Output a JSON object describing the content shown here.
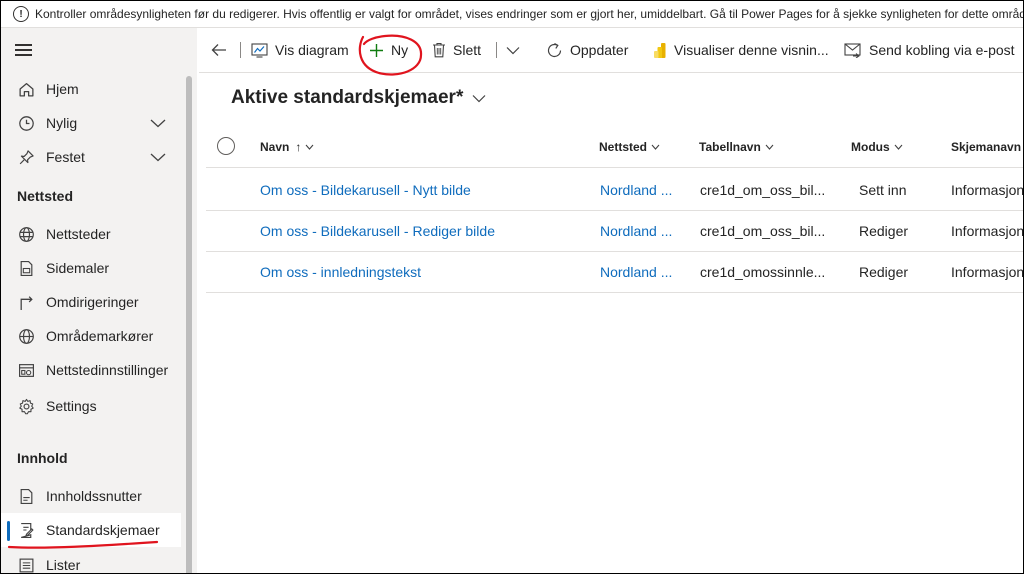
{
  "notice": {
    "icon": "info-icon",
    "text": "Kontroller områdesynligheten før du redigerer. Hvis offentlig er valgt for området, vises endringer som er gjort her, umiddelbart. Gå til Power Pages for å sjekke synligheten for dette området"
  },
  "sidebar": {
    "items": [
      {
        "label": "Hjem",
        "icon": "home-icon"
      },
      {
        "label": "Nylig",
        "icon": "clock-icon",
        "expandable": true
      },
      {
        "label": "Festet",
        "icon": "pin-icon",
        "expandable": true
      }
    ],
    "sections": [
      {
        "title": "Nettsted",
        "items": [
          {
            "label": "Nettsteder",
            "icon": "globe-icon"
          },
          {
            "label": "Sidemaler",
            "icon": "page-template-icon"
          },
          {
            "label": "Omdirigeringer",
            "icon": "redirect-icon"
          },
          {
            "label": "Områdemarkører",
            "icon": "site-marker-icon"
          },
          {
            "label": "Nettstedinnstillinger",
            "icon": "site-settings-icon"
          },
          {
            "label": "Settings",
            "icon": "gear-icon"
          }
        ]
      },
      {
        "title": "Innhold",
        "items": [
          {
            "label": "Innholdssnutter",
            "icon": "snippet-icon"
          },
          {
            "label": "Standardskjemaer",
            "icon": "form-icon",
            "selected": true
          },
          {
            "label": "Lister",
            "icon": "list-icon"
          }
        ]
      }
    ]
  },
  "commandbar": {
    "back": "back-arrow-icon",
    "vis_diagram": "Vis diagram",
    "ny": "Ny",
    "slett": "Slett",
    "oppdater": "Oppdater",
    "visualiser": "Visualiser denne visnin...",
    "send_kobling": "Send kobling via e-post"
  },
  "view": {
    "title": "Aktive standardskjemaer*"
  },
  "grid": {
    "columns": [
      "Navn",
      "Nettsted",
      "Tabellnavn",
      "Modus",
      "Skjemanavn"
    ],
    "sort_indicator": "↑",
    "rows": [
      [
        "Om oss - Bildekarusell - Nytt bilde",
        "Nordland ...",
        "cre1d_om_oss_bil...",
        "Sett inn",
        "Informasjon"
      ],
      [
        "Om oss - Bildekarusell - Rediger bilde",
        "Nordland ...",
        "cre1d_om_oss_bil...",
        "Rediger",
        "Informasjon"
      ],
      [
        "Om oss - innledningstekst",
        "Nordland ...",
        "cre1d_omossinnle...",
        "Rediger",
        "Informasjon"
      ]
    ]
  },
  "colors": {
    "accent": "#0f6cbd",
    "annotation": "#e0141e",
    "sidebar_bg": "#f3f2f1"
  }
}
